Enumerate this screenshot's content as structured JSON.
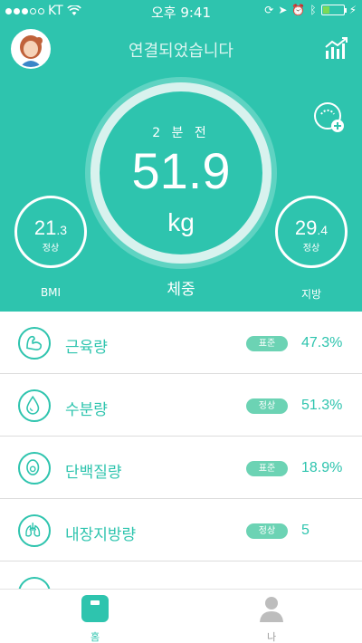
{
  "status_bar": {
    "carrier": "KT",
    "time": "오후 9:41",
    "battery_level": 0.3
  },
  "header": {
    "title": "연결되었습니다",
    "avatar_icon": "user-avatar",
    "trend_icon": "chart-trend-icon",
    "add_icon": "scale-add-icon"
  },
  "weight": {
    "ago": "2 분 전",
    "value": "51.9",
    "unit": "kg",
    "label": "체중"
  },
  "bmi": {
    "integer": "21",
    "decimal": ".3",
    "status": "정상",
    "label": "BMI"
  },
  "fat": {
    "integer": "29",
    "decimal": ".4",
    "status": "정상",
    "label": "지방"
  },
  "metrics": [
    {
      "name": "근육량",
      "badge": "표준",
      "value": "47.3%",
      "icon": "muscle-icon"
    },
    {
      "name": "수분량",
      "badge": "정상",
      "value": "51.3%",
      "icon": "water-drop-icon"
    },
    {
      "name": "단백질량",
      "badge": "표준",
      "value": "18.9%",
      "icon": "protein-egg-icon"
    },
    {
      "name": "내장지방량",
      "badge": "정상",
      "value": "5",
      "icon": "lungs-icon"
    }
  ],
  "tabs": {
    "home": "홈",
    "me": "나"
  },
  "colors": {
    "accent": "#2ec4ae",
    "badge": "#6cd3b4"
  }
}
